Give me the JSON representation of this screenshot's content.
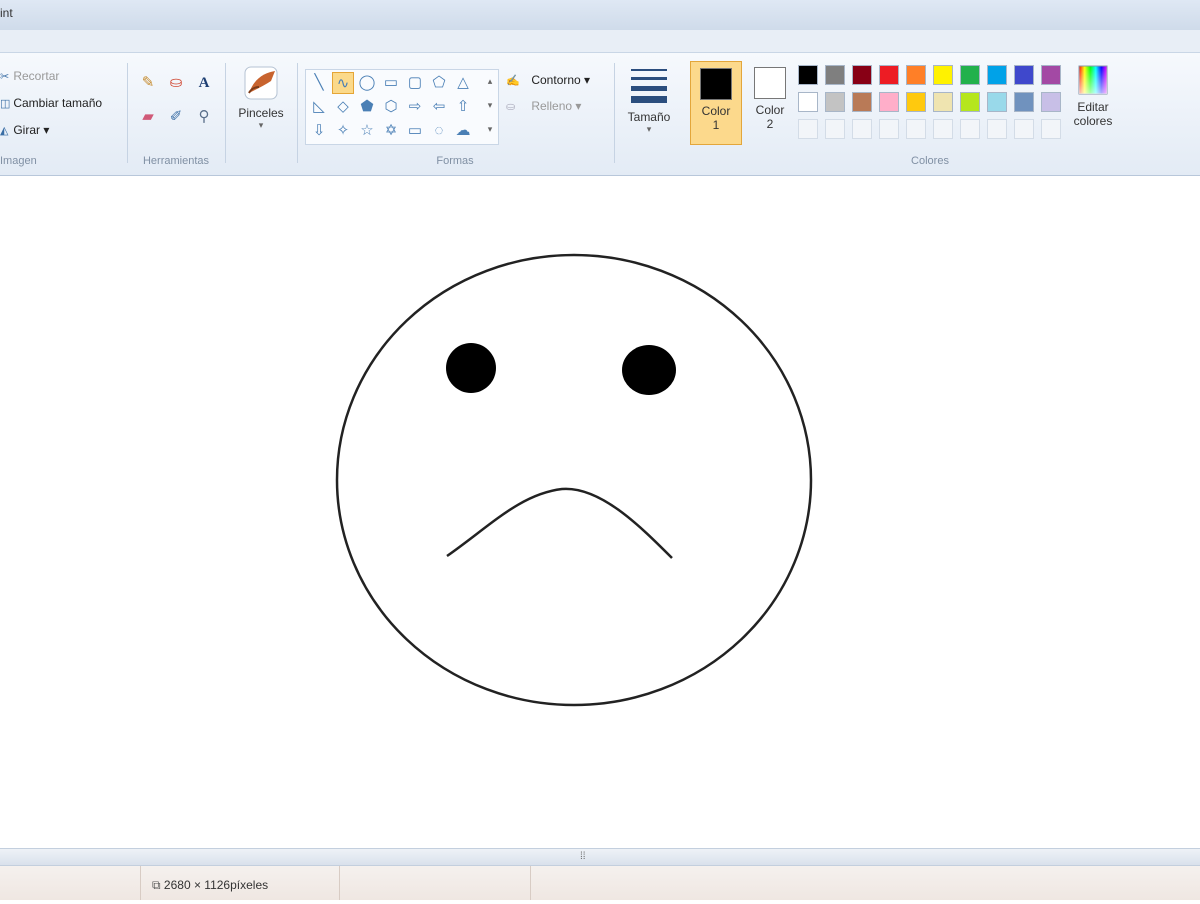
{
  "window": {
    "title": "int"
  },
  "image_group": {
    "label": "Imagen",
    "items": [
      {
        "label": "Recortar",
        "enabled": false
      },
      {
        "label": "Cambiar tamaño",
        "enabled": true
      },
      {
        "label": "Girar ▾",
        "enabled": true
      }
    ]
  },
  "tools_group": {
    "label": "Herramientas"
  },
  "brushes": {
    "label": "Pinceles",
    "arrow": "▾"
  },
  "shapes_group": {
    "label": "Formas",
    "outline_label": "Contorno ▾",
    "fill_label": "Relleno ▾"
  },
  "size": {
    "label": "Tamaño",
    "arrow": "▾"
  },
  "color1": {
    "label_line1": "Color",
    "label_line2": "1",
    "value": "#000000"
  },
  "color2": {
    "label_line1": "Color",
    "label_line2": "2",
    "value": "#ffffff"
  },
  "colors_group": {
    "label": "Colores",
    "row1": [
      "#000000",
      "#7f7f7f",
      "#880015",
      "#ed1c24",
      "#ff7f27",
      "#fff200",
      "#22b14c",
      "#00a2e8",
      "#3f48cc",
      "#a349a4"
    ],
    "row2": [
      "#ffffff",
      "#c3c3c3",
      "#b97a57",
      "#ffaec9",
      "#ffc90e",
      "#efe4b0",
      "#b5e61d",
      "#99d9ea",
      "#7092be",
      "#c8bfe7"
    ]
  },
  "edit_colors": {
    "label_line1": "Editar",
    "label_line2": "colores"
  },
  "status": {
    "canvas_size": "2680 × 1126píxeles"
  }
}
